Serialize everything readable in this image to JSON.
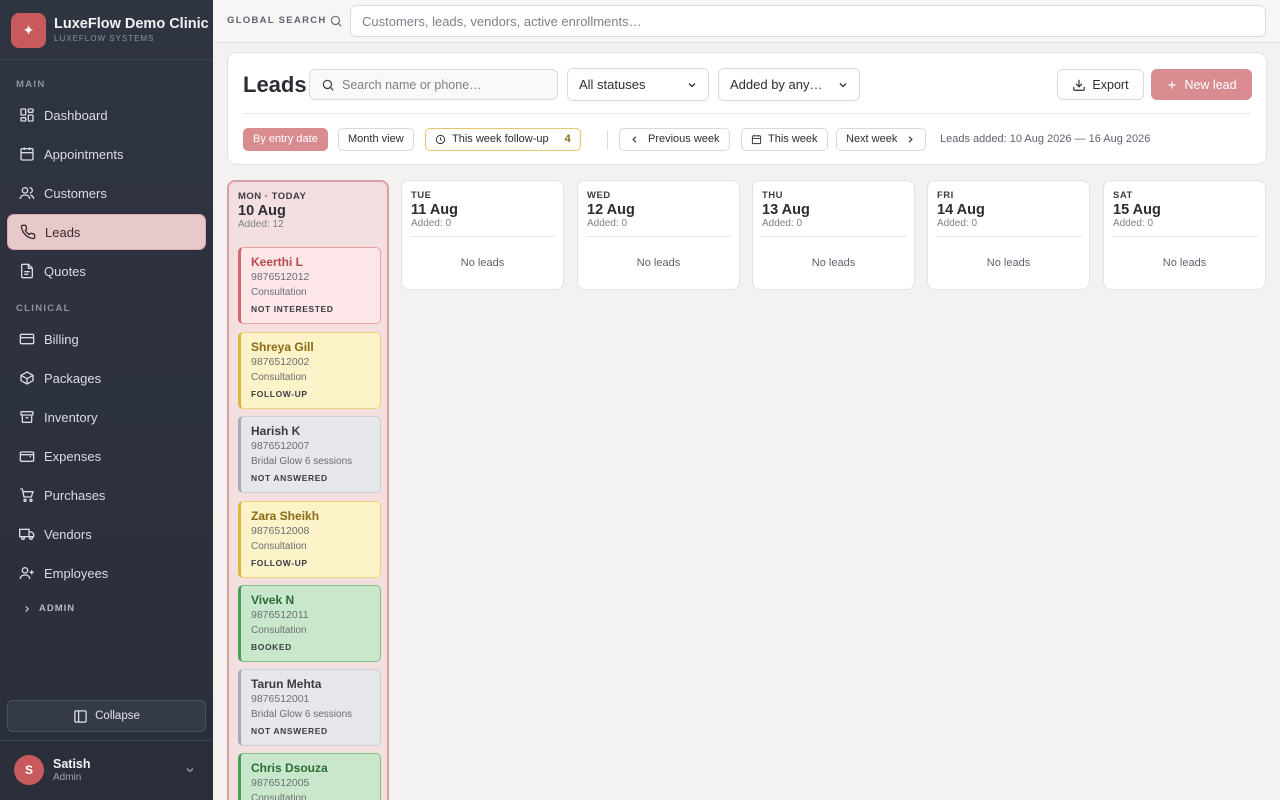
{
  "brand": {
    "logo_glyph": "✦",
    "name": "LuxeFlow Demo Clinic",
    "subtitle": "LUXEFLOW SYSTEMS"
  },
  "sidebar": {
    "main_label": "MAIN",
    "clinical_label": "CLINICAL",
    "items": [
      {
        "label": "Dashboard",
        "icon": "dashboard-icon",
        "active": false
      },
      {
        "label": "Appointments",
        "icon": "calendar-icon",
        "active": false
      },
      {
        "label": "Customers",
        "icon": "users-icon",
        "active": false
      },
      {
        "label": "Leads",
        "icon": "phone-icon",
        "active": true
      },
      {
        "label": "Quotes",
        "icon": "quote-icon",
        "active": false
      },
      {
        "label": "Billing",
        "icon": "credit-card-icon",
        "active": false
      },
      {
        "label": "Packages",
        "icon": "package-icon",
        "active": false
      },
      {
        "label": "Inventory",
        "icon": "box-icon",
        "active": false
      },
      {
        "label": "Expenses",
        "icon": "wallet-icon",
        "active": false
      },
      {
        "label": "Purchases",
        "icon": "cart-icon",
        "active": false
      },
      {
        "label": "Vendors",
        "icon": "truck-icon",
        "active": false
      },
      {
        "label": "Employees",
        "icon": "employees-icon",
        "active": false
      }
    ],
    "admin_label": "ADMIN",
    "collapse_label": "Collapse"
  },
  "user": {
    "initial": "S",
    "name": "Satish",
    "role": "Admin"
  },
  "topbar": {
    "label": "GLOBAL SEARCH",
    "placeholder": "Customers, leads, vendors, active enrollments…"
  },
  "leads": {
    "title": "Leads",
    "search_placeholder": "Search name or phone…",
    "status_select": "All statuses",
    "added_by_select": "Added by any…",
    "export_label": "Export",
    "new_lead_label": "New lead",
    "chips": {
      "by_entry_date": "By entry date",
      "month_view": "Month view",
      "this_week_followup": "This week follow-up",
      "followup_count": "4",
      "previous_week": "Previous week",
      "this_week": "This week",
      "next_week": "Next week"
    },
    "range_text": "Leads added: 10 Aug 2026 — 16 Aug 2026"
  },
  "days": [
    {
      "dow": "MON · TODAY",
      "date": "10 Aug",
      "added": "Added: 12",
      "today": true
    },
    {
      "dow": "TUE",
      "date": "11 Aug",
      "added": "Added: 0",
      "empty": "No leads"
    },
    {
      "dow": "WED",
      "date": "12 Aug",
      "added": "Added: 0",
      "empty": "No leads"
    },
    {
      "dow": "THU",
      "date": "13 Aug",
      "added": "Added: 0",
      "empty": "No leads"
    },
    {
      "dow": "FRI",
      "date": "14 Aug",
      "added": "Added: 0",
      "empty": "No leads"
    },
    {
      "dow": "SAT",
      "date": "15 Aug",
      "added": "Added: 0",
      "empty": "No leads"
    }
  ],
  "today_leads": [
    {
      "name": "Keerthi L",
      "phone": "9876512012",
      "service": "Consultation",
      "status": "NOT INTERESTED",
      "color": "#d4686d"
    },
    {
      "name": "Shreya Gill",
      "phone": "9876512002",
      "service": "Consultation",
      "status": "FOLLOW-UP",
      "color": "#dbb53d"
    },
    {
      "name": "Harish K",
      "phone": "9876512007",
      "service": "Bridal Glow 6 sessions",
      "status": "NOT ANSWERED",
      "color": "#a6aab3"
    },
    {
      "name": "Zara Sheikh",
      "phone": "9876512008",
      "service": "Consultation",
      "status": "FOLLOW-UP",
      "color": "#dbb53d"
    },
    {
      "name": "Vivek N",
      "phone": "9876512011",
      "service": "Consultation",
      "status": "BOOKED",
      "color": "#4e9f56"
    },
    {
      "name": "Tarun Mehta",
      "phone": "9876512001",
      "service": "Bridal Glow 6 sessions",
      "status": "NOT ANSWERED",
      "color": "#a6aab3"
    },
    {
      "name": "Chris Dsouza",
      "phone": "9876512005",
      "service": "Consultation",
      "status": "",
      "color": "#4e9f56"
    }
  ]
}
